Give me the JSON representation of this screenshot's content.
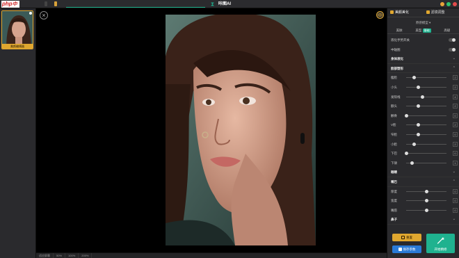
{
  "titlebar": {
    "brand_logo": "php",
    "brand_logo_cn": "中文网",
    "badge_1": "",
    "badge_2": "",
    "app_name": "咔图AI"
  },
  "left_strip": {
    "thumbnail_caption": "美颜编辑器"
  },
  "panel": {
    "tabs": [
      {
        "label": "美颜美化",
        "icon": "face-icon"
      },
      {
        "label": "滤镜调整",
        "icon": "wand-icon"
      }
    ],
    "mode_select": "原感模型",
    "subtabs": [
      {
        "label": "美肤"
      },
      {
        "label": "美型",
        "chip": "基础"
      },
      {
        "label": "高级"
      }
    ],
    "rows": [
      {
        "type": "toggle",
        "label": "液化手势开关"
      },
      {
        "type": "toggle",
        "label": "中轴图"
      },
      {
        "type": "section",
        "label": "身体液化",
        "chev": "⌄"
      },
      {
        "type": "section",
        "label": "脸部塑形",
        "chev": "⌃"
      },
      {
        "type": "slider",
        "label": "瘦脸",
        "value": "2",
        "level": 0.2
      },
      {
        "type": "slider",
        "label": "小头",
        "value": "2",
        "level": 0.3
      },
      {
        "type": "slider",
        "label": "发际线",
        "value": "4",
        "level": 0.4
      },
      {
        "type": "slider",
        "label": "额头",
        "value": "2",
        "level": 0.3
      },
      {
        "type": "slider",
        "label": "颧骨",
        "value": "0",
        "level": 0.0
      },
      {
        "type": "slider",
        "label": "V脸",
        "value": "2",
        "level": 0.3
      },
      {
        "type": "slider",
        "label": "窄脸",
        "value": "0",
        "level": 0.3
      },
      {
        "type": "slider",
        "label": "小脸",
        "value": "2",
        "level": 0.2
      },
      {
        "type": "slider",
        "label": "下巴",
        "value": "0",
        "level": 0.0
      },
      {
        "type": "slider",
        "label": "下颌",
        "value": "1",
        "level": 0.15
      },
      {
        "type": "section",
        "label": "眼睛",
        "chev": "⌄"
      },
      {
        "type": "section",
        "label": "嘴巴",
        "chev": "⌃"
      },
      {
        "type": "slider",
        "label": "厚度",
        "value": "0",
        "level": 0.5
      },
      {
        "type": "slider",
        "label": "宽度",
        "value": "0",
        "level": 0.5
      },
      {
        "type": "slider",
        "label": "嘴唇",
        "value": "0",
        "level": 0.5
      },
      {
        "type": "section",
        "label": "鼻子",
        "chev": "⌄"
      }
    ],
    "reset_label": "重置",
    "save_label": "保存参数",
    "start_label": "开始精修"
  },
  "bottombar": {
    "items": [
      "适应屏幕",
      "50%",
      "100%",
      "200%"
    ]
  },
  "colors": {
    "accent_green": "#1fb28f",
    "accent_orange": "#e0a72f",
    "accent_blue": "#2a7ad6"
  }
}
